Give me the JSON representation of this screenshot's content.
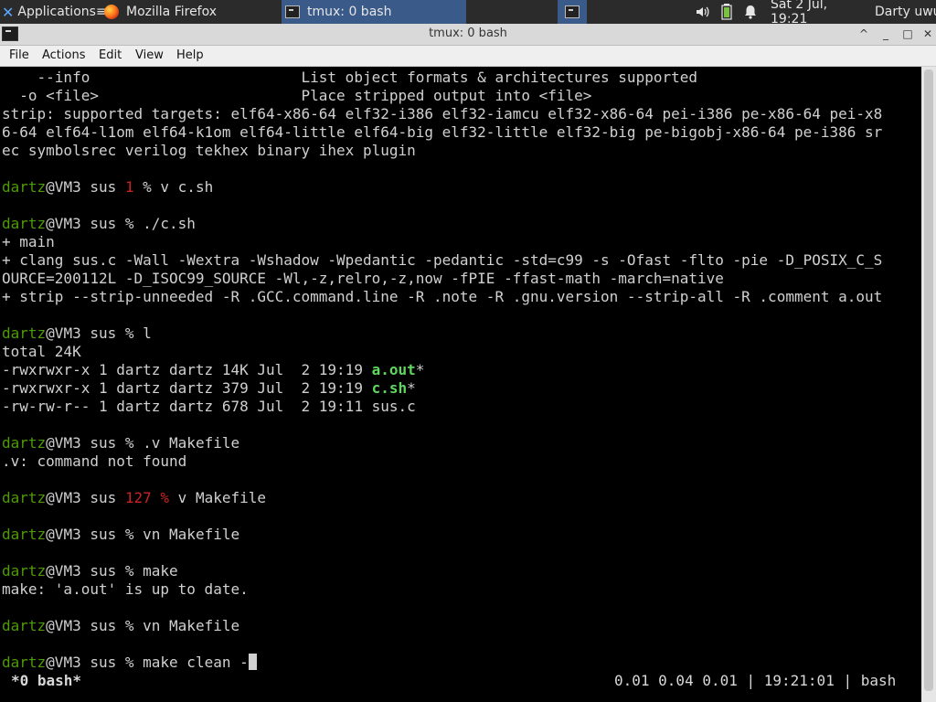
{
  "panel": {
    "applications": "Applications",
    "applications_overflow": "≡",
    "firefox_task": "Mozilla Firefox",
    "tmux_task": "tmux: 0 bash",
    "clock": "Sat  2 Jul, 19:21",
    "user": "Darty uwu"
  },
  "window": {
    "title": "tmux: 0 bash",
    "menus": [
      "File",
      "Actions",
      "Edit",
      "View",
      "Help"
    ]
  },
  "terminal": {
    "pre_lines": [
      "    --info                        List object formats & architectures supported",
      "  -o <file>                       Place stripped output into <file>",
      "strip: supported targets: elf64-x86-64 elf32-i386 elf32-iamcu elf32-x86-64 pei-i386 pe-x86-64 pei-x8",
      "6-64 elf64-l1om elf64-k1om elf64-little elf64-big elf32-little elf32-big pe-bigobj-x86-64 pe-i386 sr",
      "ec symbolsrec verilog tekhex binary ihex plugin"
    ],
    "prompt_user": "dartz",
    "prompt_rest": "@VM3 sus ",
    "prompt_char": "% ",
    "cmd1_status": "1 ",
    "cmd1": "v c.sh",
    "cmd2": "./c.sh",
    "out2": [
      "+ main",
      "+ clang sus.c -Wall -Wextra -Wshadow -Wpedantic -pedantic -std=c99 -s -Ofast -flto -pie -D_POSIX_C_S",
      "OURCE=200112L -D_ISOC99_SOURCE -Wl,-z,relro,-z,now -fPIE -ffast-math -march=native",
      "+ strip --strip-unneeded -R .GCC.command.line -R .note -R .gnu.version --strip-all -R .comment a.out"
    ],
    "cmd3": "l",
    "ls_total": "total 24K",
    "ls": [
      {
        "meta": "-rwxrwxr-x 1 dartz dartz 14K Jul  2 19:19 ",
        "name": "a.out",
        "suffix": "*"
      },
      {
        "meta": "-rwxrwxr-x 1 dartz dartz 379 Jul  2 19:19 ",
        "name": "c.sh",
        "suffix": "*"
      },
      {
        "meta": "-rw-rw-r-- 1 dartz dartz 678 Jul  2 19:11 ",
        "name": "sus.c",
        "suffix": ""
      }
    ],
    "cmd4": ".v Makefile",
    "out4": ".v: command not found",
    "cmd5_status": "127 ",
    "cmd5": "v Makefile",
    "cmd6": "vn Makefile",
    "cmd7": "make",
    "out7": "make: 'a.out' is up to date.",
    "cmd8": "vn Makefile",
    "cmd9": "make clean -"
  },
  "tmux_status": {
    "left": "*0 bash*",
    "right": "0.01 0.04 0.01 | 19:21:01 | bash"
  },
  "colors": {
    "prompt_user": "#4e9a06",
    "error_status": "#cc2222",
    "executable": "#5fd75f",
    "active_task": "#3a5a8a"
  }
}
